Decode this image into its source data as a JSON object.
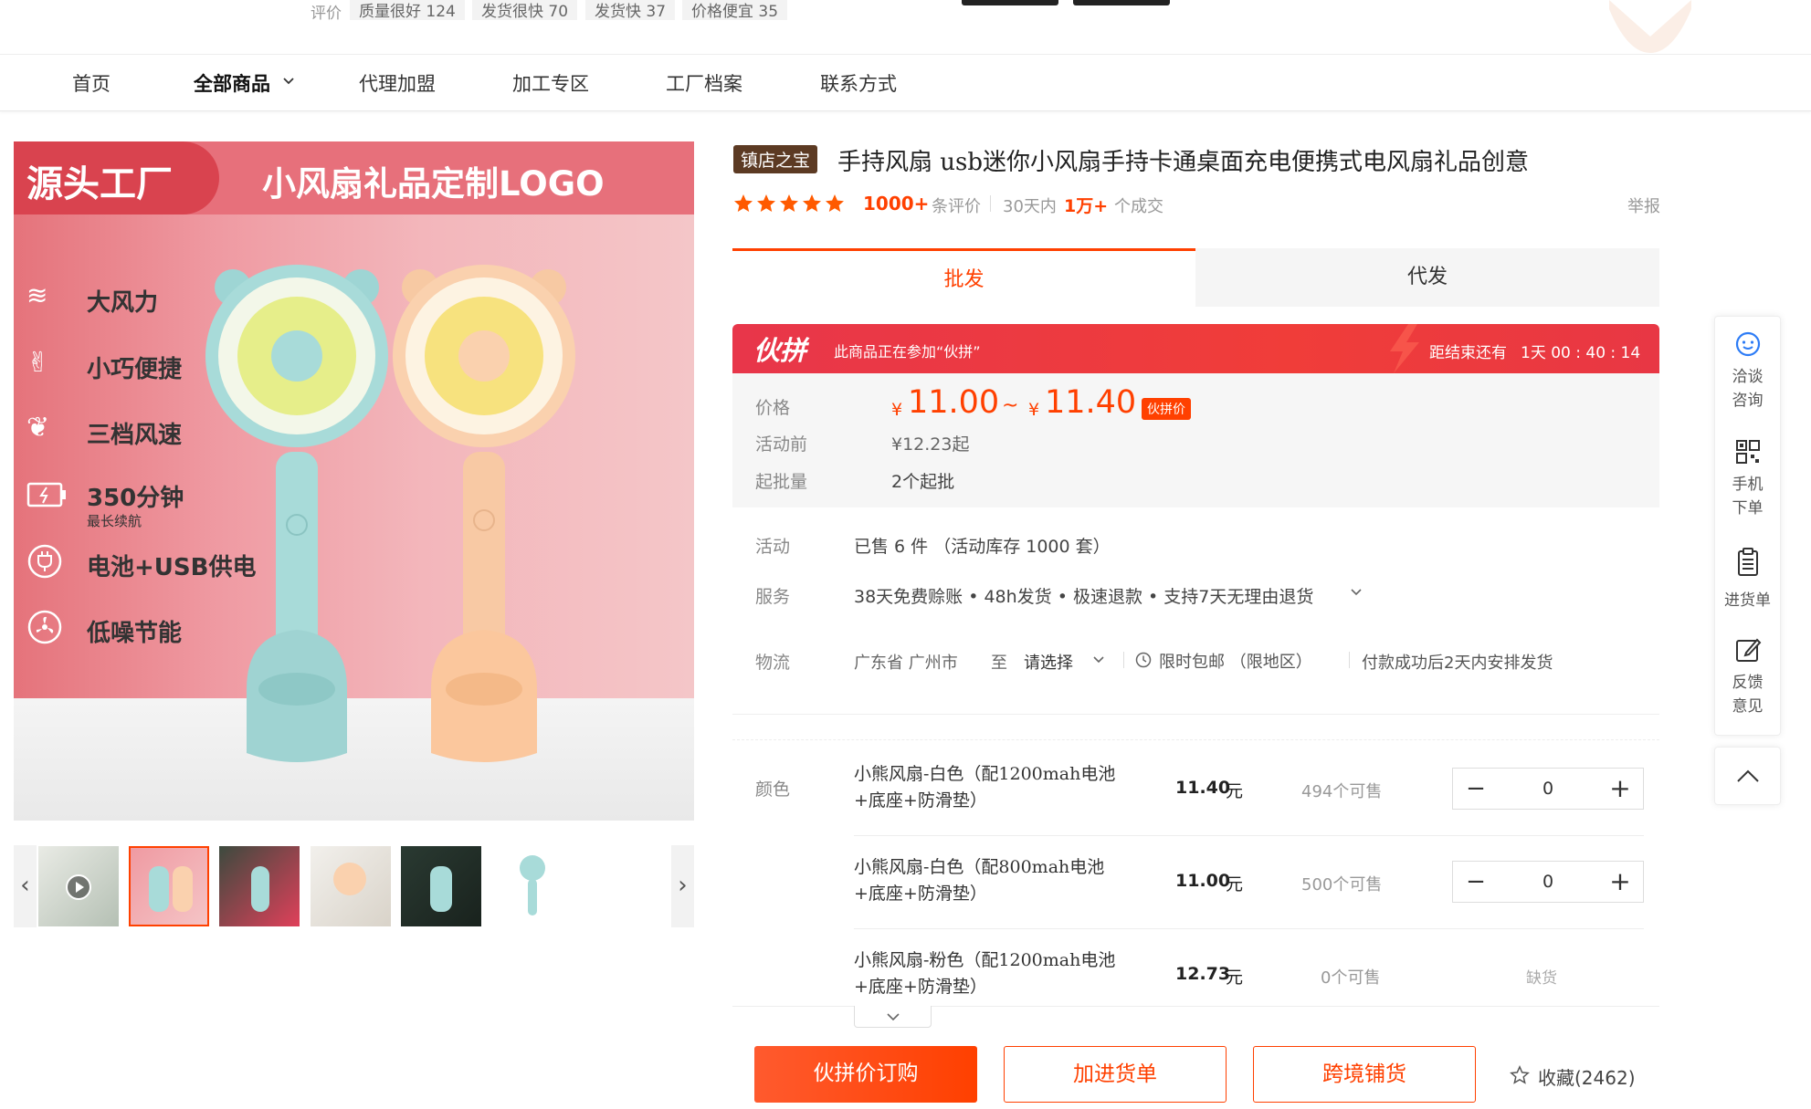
{
  "top_reviews": {
    "label": "评价",
    "tags": [
      "质量很好 124",
      "发货很快 70",
      "发货快 37",
      "价格便宜 35"
    ]
  },
  "nav": {
    "items": [
      "首页",
      "全部商品",
      "代理加盟",
      "加工专区",
      "工厂档案",
      "联系方式"
    ]
  },
  "gallery": {
    "banner_left": "源头工厂",
    "banner_right": "小风扇礼品定制LOGO",
    "features": [
      {
        "icon": "wind-icon",
        "text": "大风力",
        "sub": ""
      },
      {
        "icon": "hand-icon",
        "text": "小巧便捷",
        "sub": ""
      },
      {
        "icon": "leaf-icon",
        "text": "三档风速",
        "sub": ""
      },
      {
        "icon": "battery-icon",
        "text": "350分钟",
        "sub": "最长续航"
      },
      {
        "icon": "plug-icon",
        "text": "电池+USB供电",
        "sub": ""
      },
      {
        "icon": "fan-icon",
        "text": "低噪节能",
        "sub": ""
      }
    ],
    "prev_arrow": "‹",
    "next_arrow": "›"
  },
  "product": {
    "shop_badge": "镇店之宝",
    "title": "手持风扇 usb迷你小风扇手持卡通桌面充电便携式电风扇礼品创意",
    "rating_count": "1000+",
    "rating_suffix": "条评价",
    "sold_prefix": "30天内",
    "sold_count": "1万+",
    "sold_suffix": "个成交",
    "report": "举报"
  },
  "tabs": {
    "wholesale": "批发",
    "dropship": "代发"
  },
  "groupbuy": {
    "logo": "伙拼",
    "notice": "此商品正在参加“伙拼”",
    "countdown_label": "距结束还有",
    "countdown": "1天 00 : 40 : 14"
  },
  "price": {
    "label": "价格",
    "currency": "¥",
    "low": "11.00",
    "tilde": "~",
    "high": "11.40",
    "badge": "伙拼价",
    "before_label": "活动前",
    "before_value": "¥12.23起",
    "moq_label": "起批量",
    "moq_value": "2个起批"
  },
  "info": {
    "activity_label": "活动",
    "activity_value": "已售 6 件 （活动库存 1000 套）",
    "service_label": "服务",
    "service_value": "38天免费赊账 • 48h发货 • 极速退款 • 支持7天无理由退货",
    "logistics_label": "物流",
    "origin": "广东省 广州市",
    "to": "至",
    "dest": "请选择",
    "free_ship": "限时包邮 （限地区）",
    "ship_time": "付款成功后2天内安排发货"
  },
  "sku": {
    "label": "颜色",
    "items": [
      {
        "name": "小熊风扇-白色（配1200mah电池+底座+防滑垫）",
        "price": "11.40",
        "unit": "元",
        "avail": "494个可售",
        "qty": "0",
        "state": ""
      },
      {
        "name": "小熊风扇-白色（配800mah电池+底座+防滑垫）",
        "price": "11.00",
        "unit": "元",
        "avail": "500个可售",
        "qty": "0",
        "state": ""
      },
      {
        "name": "小熊风扇-粉色（配1200mah电池+底座+防滑垫）",
        "price": "12.73",
        "unit": "元",
        "avail": "0个可售",
        "qty": "",
        "state": "缺货"
      }
    ],
    "minus": "−",
    "plus": "+"
  },
  "actions": {
    "buy": "伙拼价订购",
    "add_cart": "加进货单",
    "cross_border": "跨境铺货",
    "favorite": "收藏(2462)"
  },
  "sidebar": {
    "consult": "洽谈咨询",
    "mobile_order": "手机下单",
    "cart": "进货单",
    "feedback": "反馈意见"
  },
  "colors": {
    "accent": "#ff4000",
    "groupbuy_red": "#e8364a",
    "shop_badge": "#5c3a23"
  }
}
